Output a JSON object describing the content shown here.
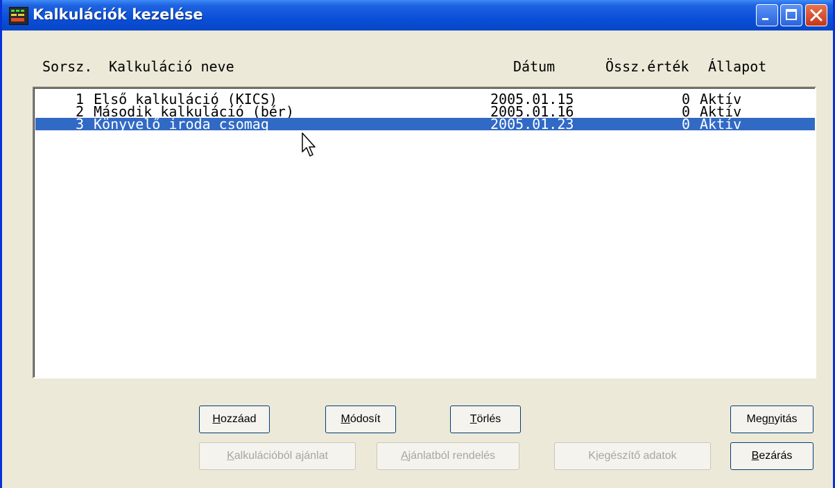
{
  "window": {
    "title": "Kalkulációk kezelése"
  },
  "columns": {
    "sorsz": "Sorsz.",
    "name": "Kalkuláció neve",
    "date": "Dátum",
    "value": "Össz.érték",
    "status": "Állapot"
  },
  "rows": [
    {
      "num": "1",
      "name": "Első kalkuláció (KICS)",
      "date": "2005.01.15",
      "value": "0",
      "status": "Aktív",
      "selected": false
    },
    {
      "num": "2",
      "name": "Második kalkuláció (bér)",
      "date": "2005.01.16",
      "value": "0",
      "status": "Aktív",
      "selected": false
    },
    {
      "num": "3",
      "name": "Könyvelő iroda csomag",
      "date": "2005.01.23",
      "value": "0",
      "status": "Aktív",
      "selected": true
    }
  ],
  "buttons": {
    "add": {
      "pre": "",
      "ul": "H",
      "post": "ozzáad"
    },
    "modify": {
      "pre": "",
      "ul": "M",
      "post": "ódosít"
    },
    "delete": {
      "pre": "",
      "ul": "T",
      "post": "örlés"
    },
    "open": {
      "pre": "Meg",
      "ul": "n",
      "post": "yitás"
    },
    "offer_from_calc": {
      "pre": "",
      "ul": "K",
      "post": "alkulációból ajánlat"
    },
    "order_from_offer": {
      "pre": "",
      "ul": "A",
      "post": "jánlatból rendelés"
    },
    "extra_data": {
      "pre": "K",
      "ul": "i",
      "post": "egészítő adatok"
    },
    "close": {
      "pre": "",
      "ul": "B",
      "post": "ezárás"
    }
  },
  "colors": {
    "selection": "#316AC5",
    "titlebar": "#0A4FD8",
    "face": "#ECE9D8"
  }
}
